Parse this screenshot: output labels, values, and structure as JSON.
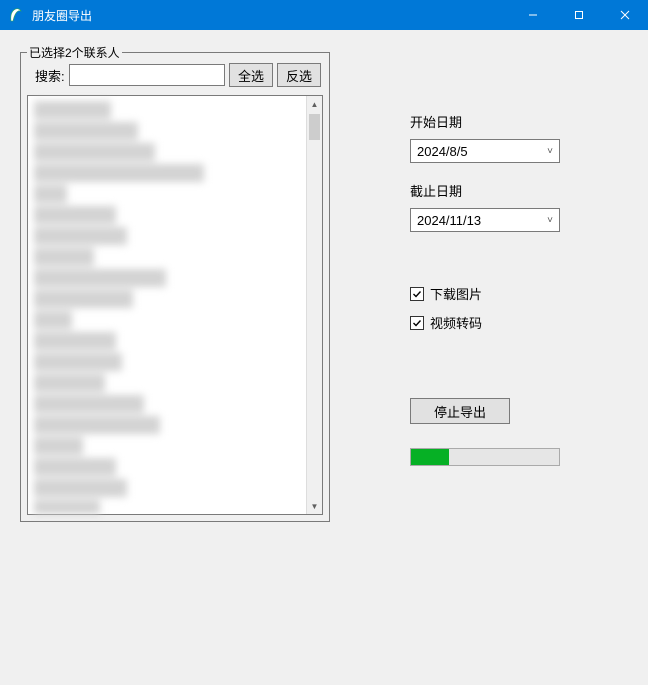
{
  "window": {
    "title": "朋友圈导出"
  },
  "left": {
    "legend": "已选择2个联系人",
    "search_label": "搜索:",
    "search_value": "",
    "select_all": "全选",
    "invert": "反选"
  },
  "right": {
    "start_label": "开始日期",
    "start_value": "2024/8/5",
    "end_label": "截止日期",
    "end_value": "2024/11/13",
    "download_images": "下载图片",
    "download_images_checked": true,
    "video_transcode": "视频转码",
    "video_transcode_checked": true,
    "action_button": "停止导出",
    "progress_percent": 26
  },
  "list_stub_widths": [
    28,
    38,
    44,
    62,
    12,
    30,
    34,
    22,
    48,
    36,
    14,
    30,
    32,
    26,
    40,
    46,
    18,
    30,
    34,
    24,
    20,
    44,
    56
  ]
}
